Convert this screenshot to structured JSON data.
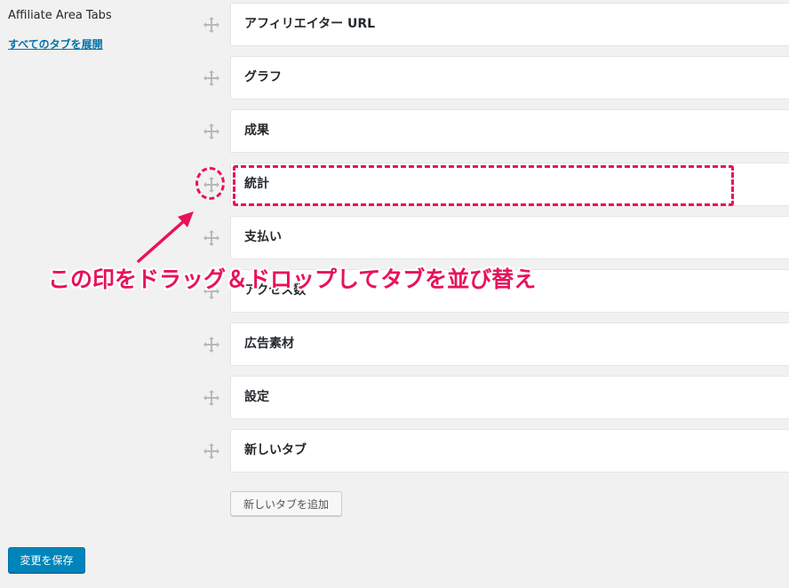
{
  "section": {
    "title": "Affiliate Area Tabs",
    "expand_all_link": "すべてのタブを展開"
  },
  "tabs": [
    {
      "label": "アフィリエイター URL"
    },
    {
      "label": "グラフ"
    },
    {
      "label": "成果"
    },
    {
      "label": "統計"
    },
    {
      "label": "支払い"
    },
    {
      "label": "アクセス数"
    },
    {
      "label": "広告素材"
    },
    {
      "label": "設定"
    },
    {
      "label": "新しいタブ"
    }
  ],
  "buttons": {
    "add_tab": "新しいタブを追加",
    "save": "変更を保存"
  },
  "annotation": {
    "text": "この印をドラッグ＆ドロップしてタブを並び替え",
    "color": "#e8125c"
  },
  "icons": {
    "drag_handle": "move-arrows-icon"
  },
  "colors": {
    "background": "#f1f1f1",
    "link": "#0073aa",
    "primary_button": "#0085ba",
    "handle": "#b4b9be"
  }
}
